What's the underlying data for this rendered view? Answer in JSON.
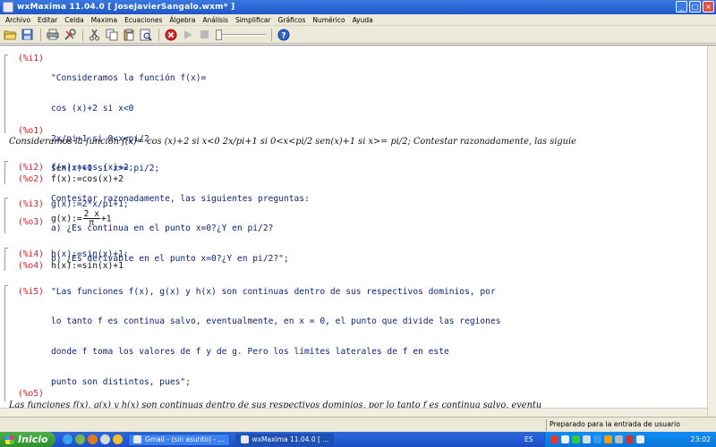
{
  "window": {
    "title": "wxMaxima 11.04.0  [ JoseJavierSangalo.wxm* ]"
  },
  "menu": [
    "Archivo",
    "Editar",
    "Celda",
    "Maxima",
    "Ecuaciones",
    "Álgebra",
    "Análisis",
    "Simplificar",
    "Gráficos",
    "Numérico",
    "Ayuda"
  ],
  "toolbar": {
    "icons": [
      "open-folder-icon",
      "save-icon",
      "print-icon",
      "config-icon",
      "cut-icon",
      "copy-icon",
      "paste-icon",
      "find-icon",
      "interrupt-icon",
      "play-icon",
      "stop-icon",
      "animation-slider",
      "help-icon"
    ]
  },
  "cells": {
    "c1": {
      "in_label": "(%i1)",
      "in_lines": [
        "\"Consideramos la función f(x)=",
        "cos (x)+2 si x<0",
        "2x/pi+1 si 0<x<pi/2",
        "sen(x)+1 si x>= pi/2;",
        "Contestar razonadamente, las siguientes preguntas:",
        "a) ¿Es continua en el punto x=0?¿Y en pi/2?",
        "b) ¿Es derivable en el punto x=0?¿Y en pi/2?\";"
      ],
      "out_label": "(%o1)",
      "out_text": "Consideramos la función f(x)=  cos (x)+2 si x<0 2x/pi+1 si 0<x<pi/2 sen(x)+1 si x>= pi/2; Contestar razonadamente, las siguie"
    },
    "c2": {
      "in_label": "(%i2)",
      "in_text": "f(x):=cos (x)+2;",
      "out_label": "(%o2)",
      "out_text": "f(x):=cos(x)+2"
    },
    "c3": {
      "in_label": "(%i3)",
      "in_text": "g(x):=2*x/pi+1;",
      "out_label": "(%o3)",
      "out_prefix": "g(x):=",
      "out_num": "2 x",
      "out_den": "π",
      "out_suffix": "+1"
    },
    "c4": {
      "in_label": "(%i4)",
      "in_text": "h(x):=sin(x)+1;",
      "out_label": "(%o4)",
      "out_text": "h(x):=sin(x)+1"
    },
    "c5": {
      "in_label": "(%i5)",
      "in_lines": [
        "\"Las funciones f(x), g(x) y h(x) son continuas dentro de sus respectivos dominios, por",
        "lo tanto f es continua salvo, eventualmente, en x = 0, el punto que divide las regiones",
        "donde f toma los valores de f y de g. Pero los límites laterales de f en este",
        "punto son distintos, pues\";"
      ],
      "out_label": "(%o5)",
      "out_text": "Las funciones f(x), g(x) y h(x) son continuas dentro de sus respectivos dominios, por  lo tanto f es continua salvo, eventu"
    }
  },
  "status": {
    "text": "Preparado para la entrada de usuario"
  },
  "taskbar": {
    "start_label": "Inicio",
    "tasks": [
      "Gmail - (sin asunto) - ...",
      "wxMaxima 11.04.0 [ ..."
    ],
    "lang": "ES",
    "clock": "23:02"
  }
}
